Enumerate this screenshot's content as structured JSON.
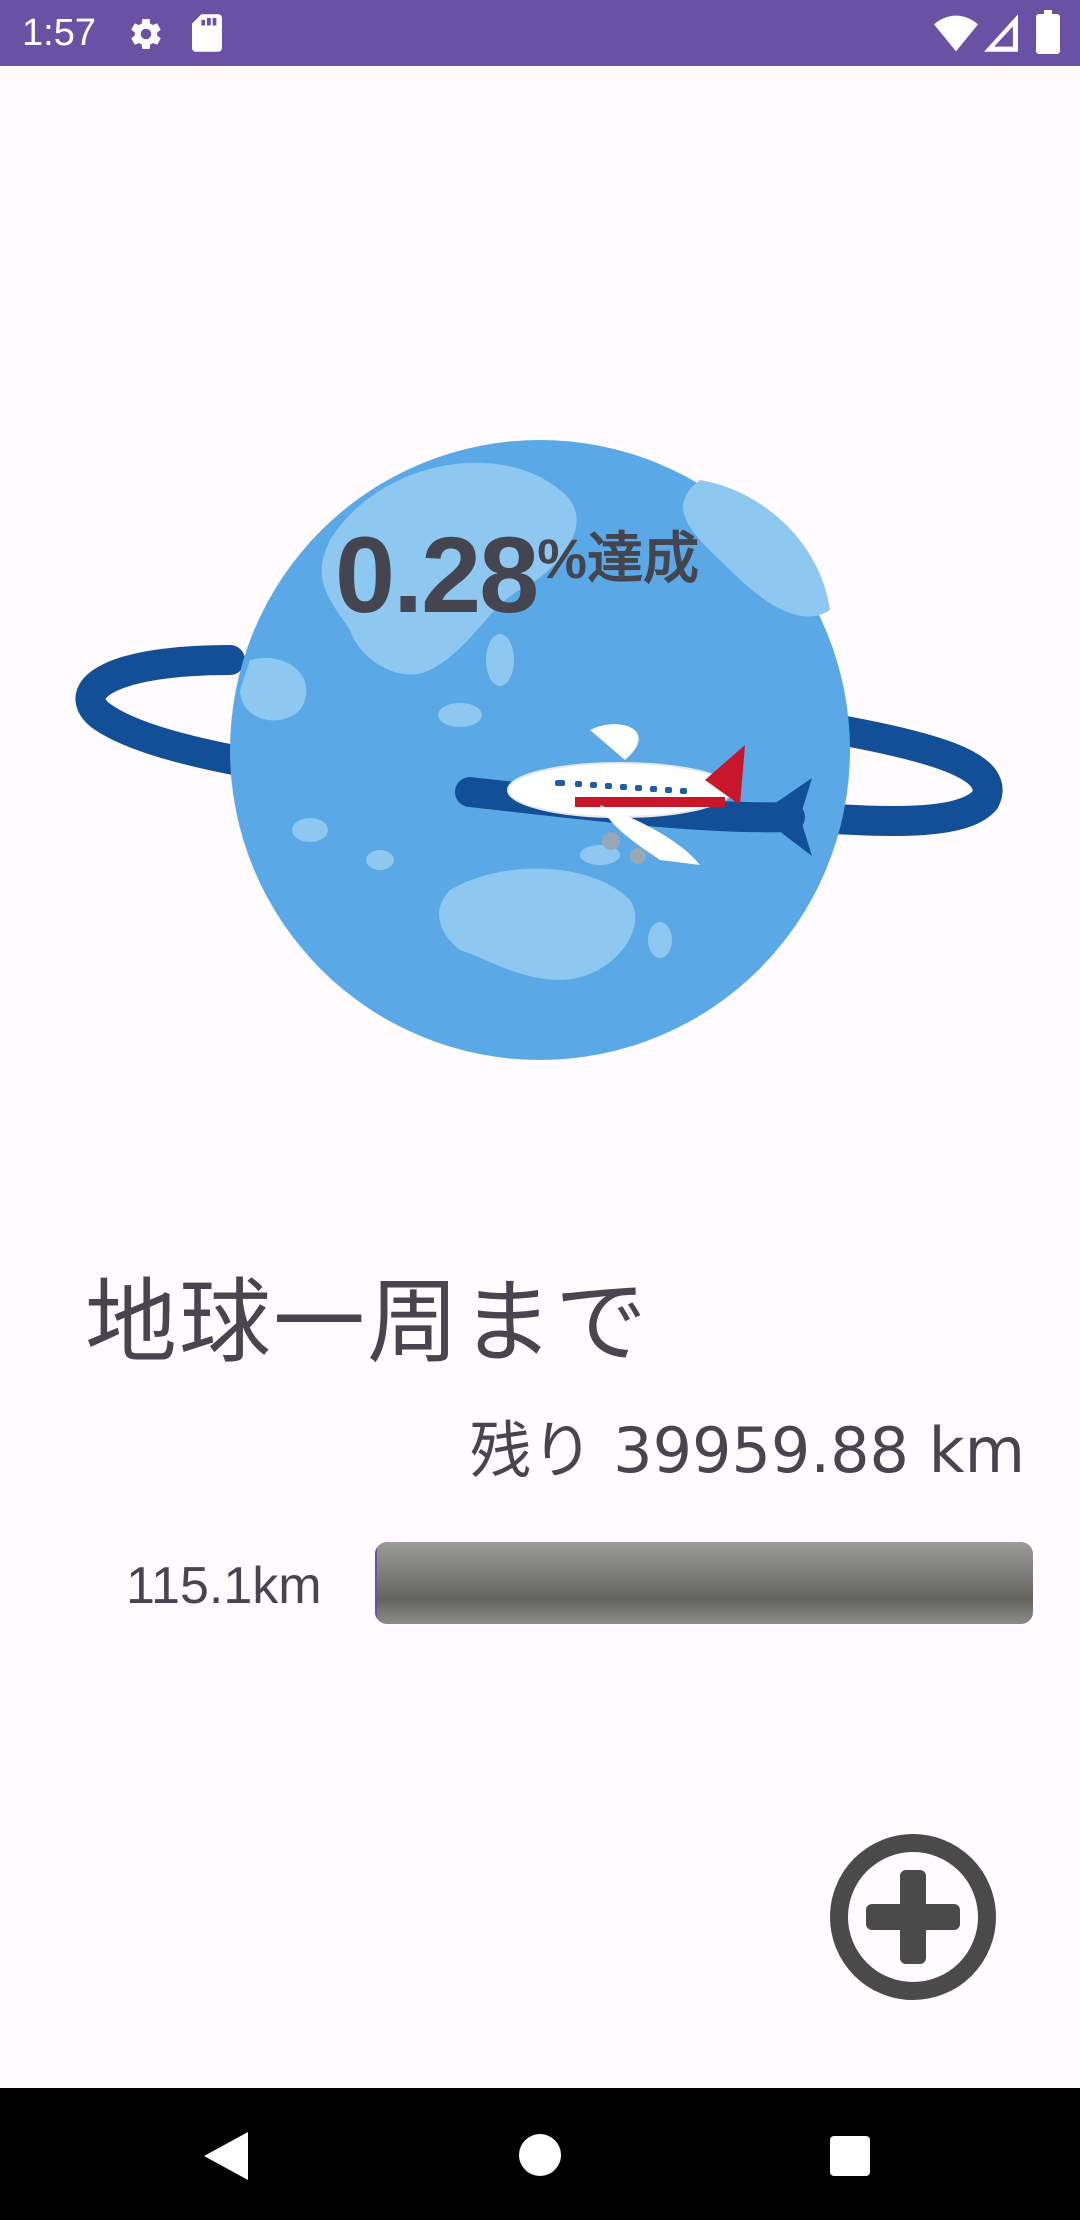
{
  "status_bar": {
    "time": "1:57",
    "icons": [
      "settings-icon",
      "sd-card-icon",
      "wifi-icon",
      "signal-icon",
      "battery-icon"
    ],
    "background": "#6a51a3"
  },
  "illustration": {
    "description_icon": "globe-airplane-icon",
    "achievement_value": "0.28",
    "achievement_suffix": "%達成"
  },
  "main": {
    "heading": "地球一周まで",
    "remaining": "残り 39959.88 km",
    "distance_label": "115.1km",
    "progress_fraction": 0.0028
  },
  "actions": {
    "add_icon": "add-circle-icon"
  },
  "nav_bar": {
    "icons": [
      "back-icon",
      "home-icon",
      "recents-icon"
    ]
  },
  "colors": {
    "accent": "#6a51a3",
    "globe": "#5aa8e6",
    "ring": "#134f96",
    "text": "#49454f"
  }
}
